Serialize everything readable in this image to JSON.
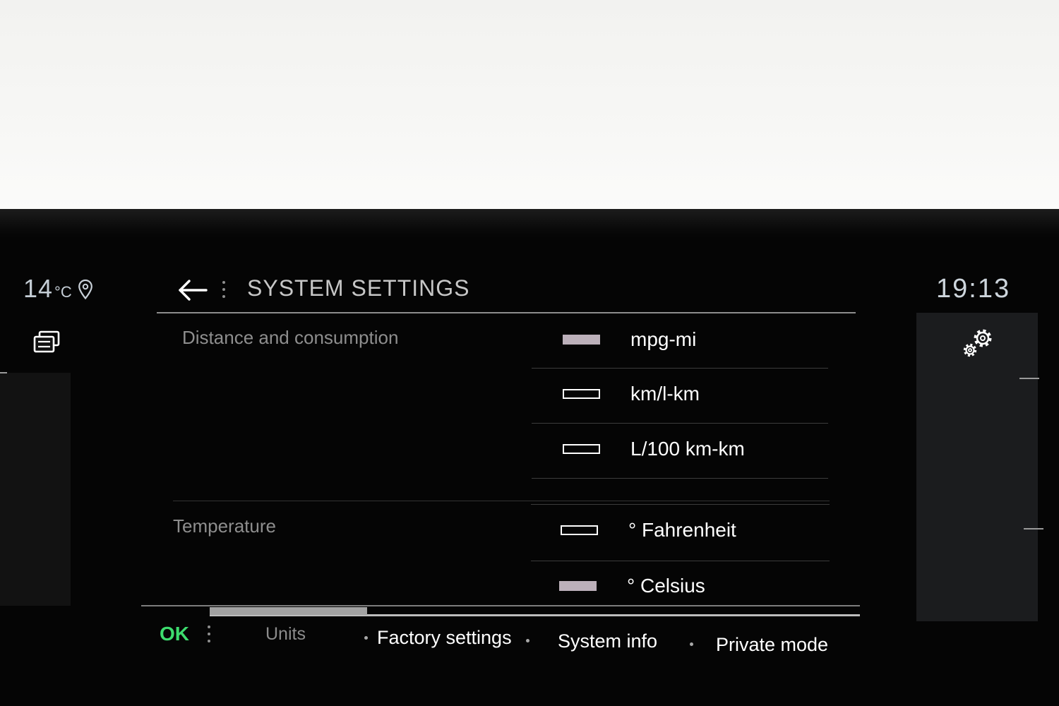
{
  "status": {
    "temperature": "14",
    "temperature_unit": "°C",
    "time": "19:13"
  },
  "header": {
    "title": "SYSTEM SETTINGS"
  },
  "sections": [
    {
      "label": "Distance and consumption",
      "options": [
        {
          "label": "mpg-mi",
          "selected": true
        },
        {
          "label": "km/l-km",
          "selected": false
        },
        {
          "label": "L/100 km-km",
          "selected": false
        }
      ]
    },
    {
      "label": "Temperature",
      "options": [
        {
          "label": "° Fahrenheit",
          "selected": false
        },
        {
          "label": "° Celsius",
          "selected": true
        }
      ]
    }
  ],
  "footer": {
    "ok_label": "OK",
    "tabs": [
      {
        "label": "Units",
        "active": true
      },
      {
        "label": "Factory settings",
        "active": false
      },
      {
        "label": "System info",
        "active": false
      },
      {
        "label": "Private mode",
        "active": false
      }
    ]
  },
  "icons": {
    "location": "location-pin-icon",
    "apps": "recent-apps-icon",
    "back": "back-arrow-icon",
    "more": "more-options-icon",
    "settings": "settings-gear-icon"
  },
  "colors": {
    "ok_accent": "#3ddc6e",
    "selected_indicator": "#bcb0ba",
    "screen_background": "#050505",
    "side_panel": "#1b1c1e"
  }
}
